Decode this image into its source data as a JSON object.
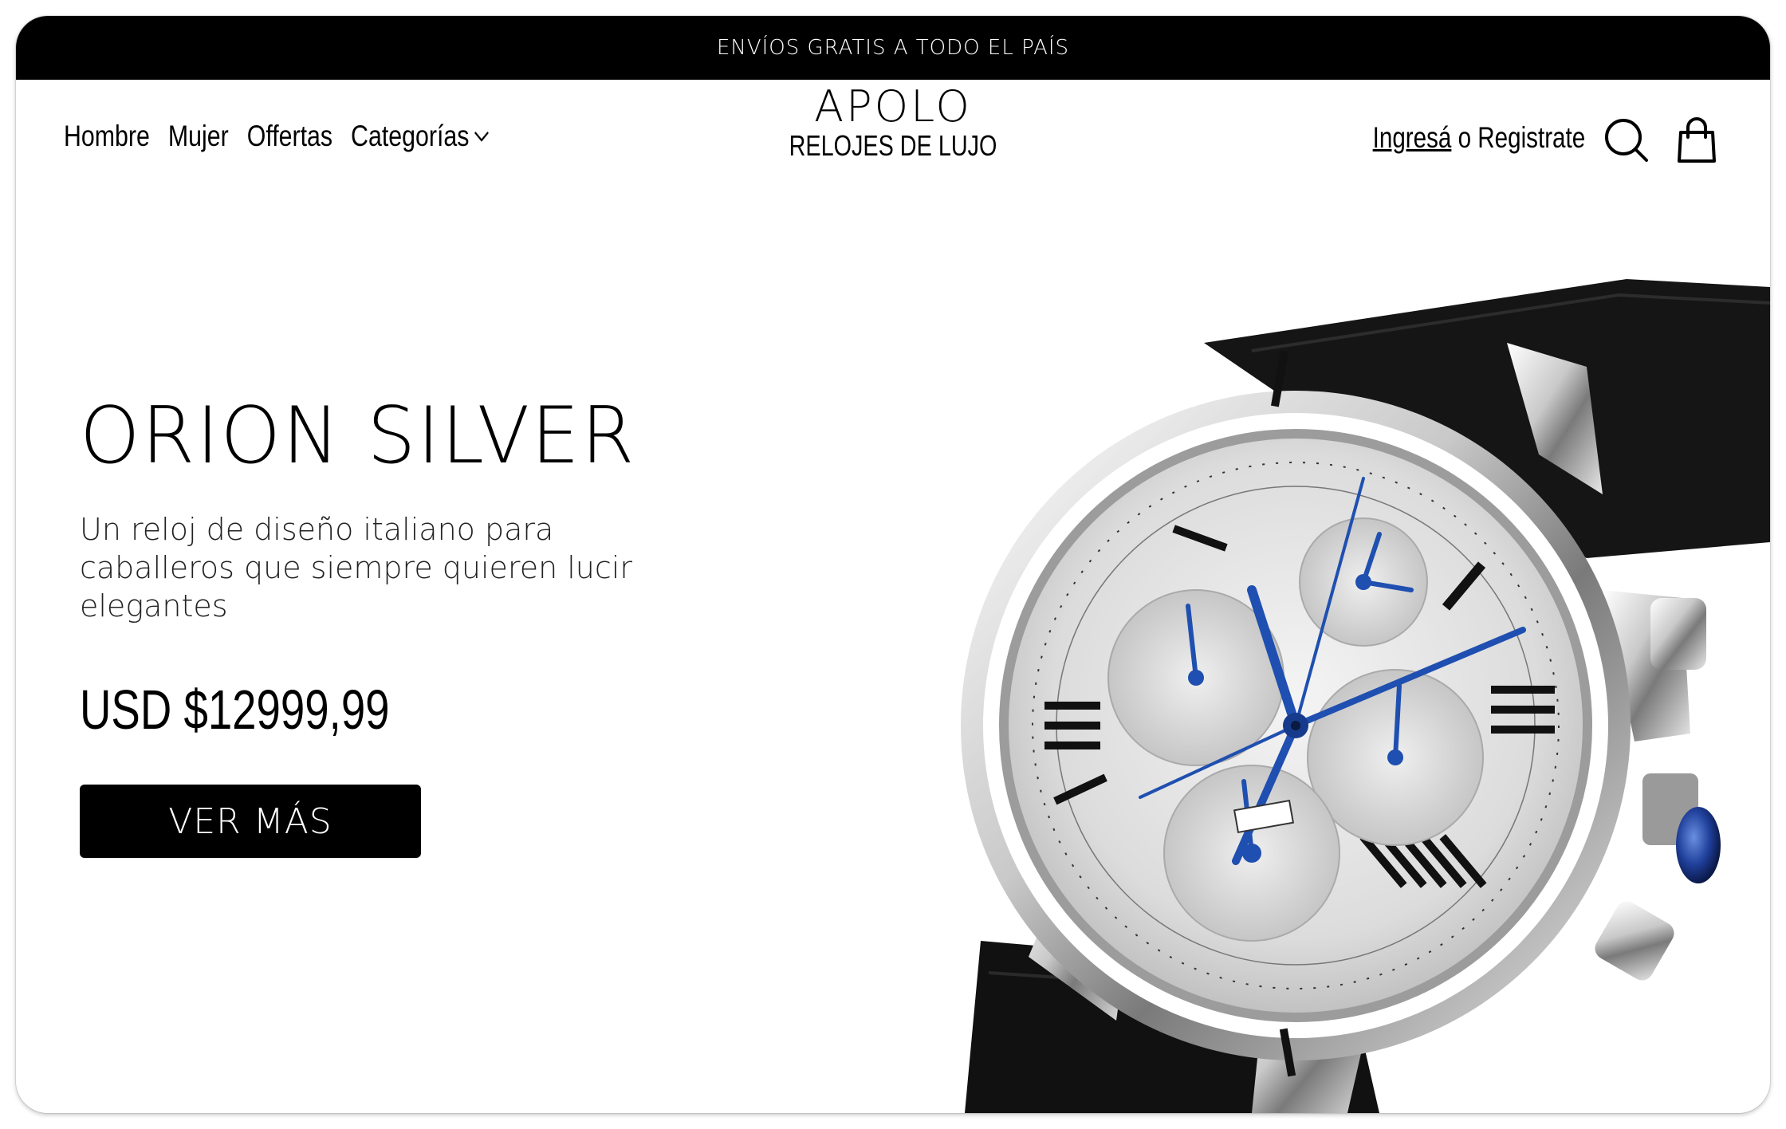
{
  "promo": {
    "text": "ENVÍOS GRATIS A TODO EL PAÍS"
  },
  "nav": {
    "items": [
      {
        "label": "Hombre"
      },
      {
        "label": "Mujer"
      },
      {
        "label": "Offertas"
      },
      {
        "label": "Categorías"
      }
    ]
  },
  "brand": {
    "name": "APOLO",
    "subtitle": "RELOJES DE LUJO"
  },
  "account": {
    "login_label": "Ingresá",
    "separator": "o",
    "register_label": "Registrate"
  },
  "icons": {
    "search": "search-icon",
    "cart": "shopping-bag-icon",
    "dropdown": "chevron-down-icon"
  },
  "hero": {
    "title": "ORION SILVER",
    "description": "Un reloj de diseño italiano para caballeros que siempre quieren lucir elegantes",
    "price": "USD $12999,99",
    "cta_label": "VER MÁS"
  },
  "colors": {
    "primary": "#000000",
    "background": "#ffffff",
    "watch_accent": "#1f4fb0"
  }
}
